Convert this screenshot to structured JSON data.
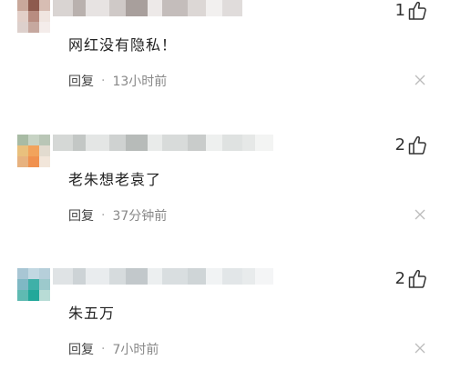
{
  "comments": [
    {
      "text": "网红没有隐私！",
      "likes": "1",
      "reply_label": "回复",
      "separator": "·",
      "time": "13小时前",
      "avatar_colors": [
        "#c9a89b",
        "#8e5b4e",
        "#d7bdb3",
        "#e2cfc8",
        "#b88c80",
        "#f0e5e0",
        "#ddd0cc",
        "#c6a89f",
        "#f4ecea"
      ],
      "username_colors": [
        "#d9d4d2",
        "#b9b1ae",
        "#e7e3e2",
        "#cfc9c7",
        "#a89f9c",
        "#ede9e8",
        "#c4bdbb",
        "#dcd7d5",
        "#f2f0ef",
        "#e0dcdb"
      ]
    },
    {
      "text": "老朱想老袁了",
      "likes": "2",
      "reply_label": "回复",
      "separator": "·",
      "time": "37分钟前",
      "avatar_colors": [
        "#a8bba4",
        "#c7d3c4",
        "#b9c6b6",
        "#e9c07d",
        "#f2a35c",
        "#e2dbcf",
        "#e7b27f",
        "#f0914f",
        "#f2e6da"
      ],
      "username_colors": [
        "#d5d8d6",
        "#c3c7c5",
        "#e4e6e5",
        "#cfd2d1",
        "#b7bbb9",
        "#e9ebea",
        "#d8dbda",
        "#c9cccb",
        "#eef0ef",
        "#dfe2e1",
        "#e6e8e7",
        "#f3f4f3"
      ]
    },
    {
      "text": "朱五万",
      "likes": "2",
      "reply_label": "回复",
      "separator": "·",
      "time": "7小时前",
      "avatar_colors": [
        "#a8c6d4",
        "#c2d8e2",
        "#b6cfda",
        "#7fb8c4",
        "#3fb0a8",
        "#9cc9cc",
        "#5fbab2",
        "#22a89a",
        "#b8dcd6"
      ],
      "username_colors": [
        "#dfe3e5",
        "#cdd3d6",
        "#e9ecee",
        "#d6dbdd",
        "#c2c8cb",
        "#eceff0",
        "#d9dee0",
        "#cfd5d7",
        "#f1f3f4",
        "#e2e6e8",
        "#e8ebec",
        "#f4f5f6"
      ]
    }
  ]
}
